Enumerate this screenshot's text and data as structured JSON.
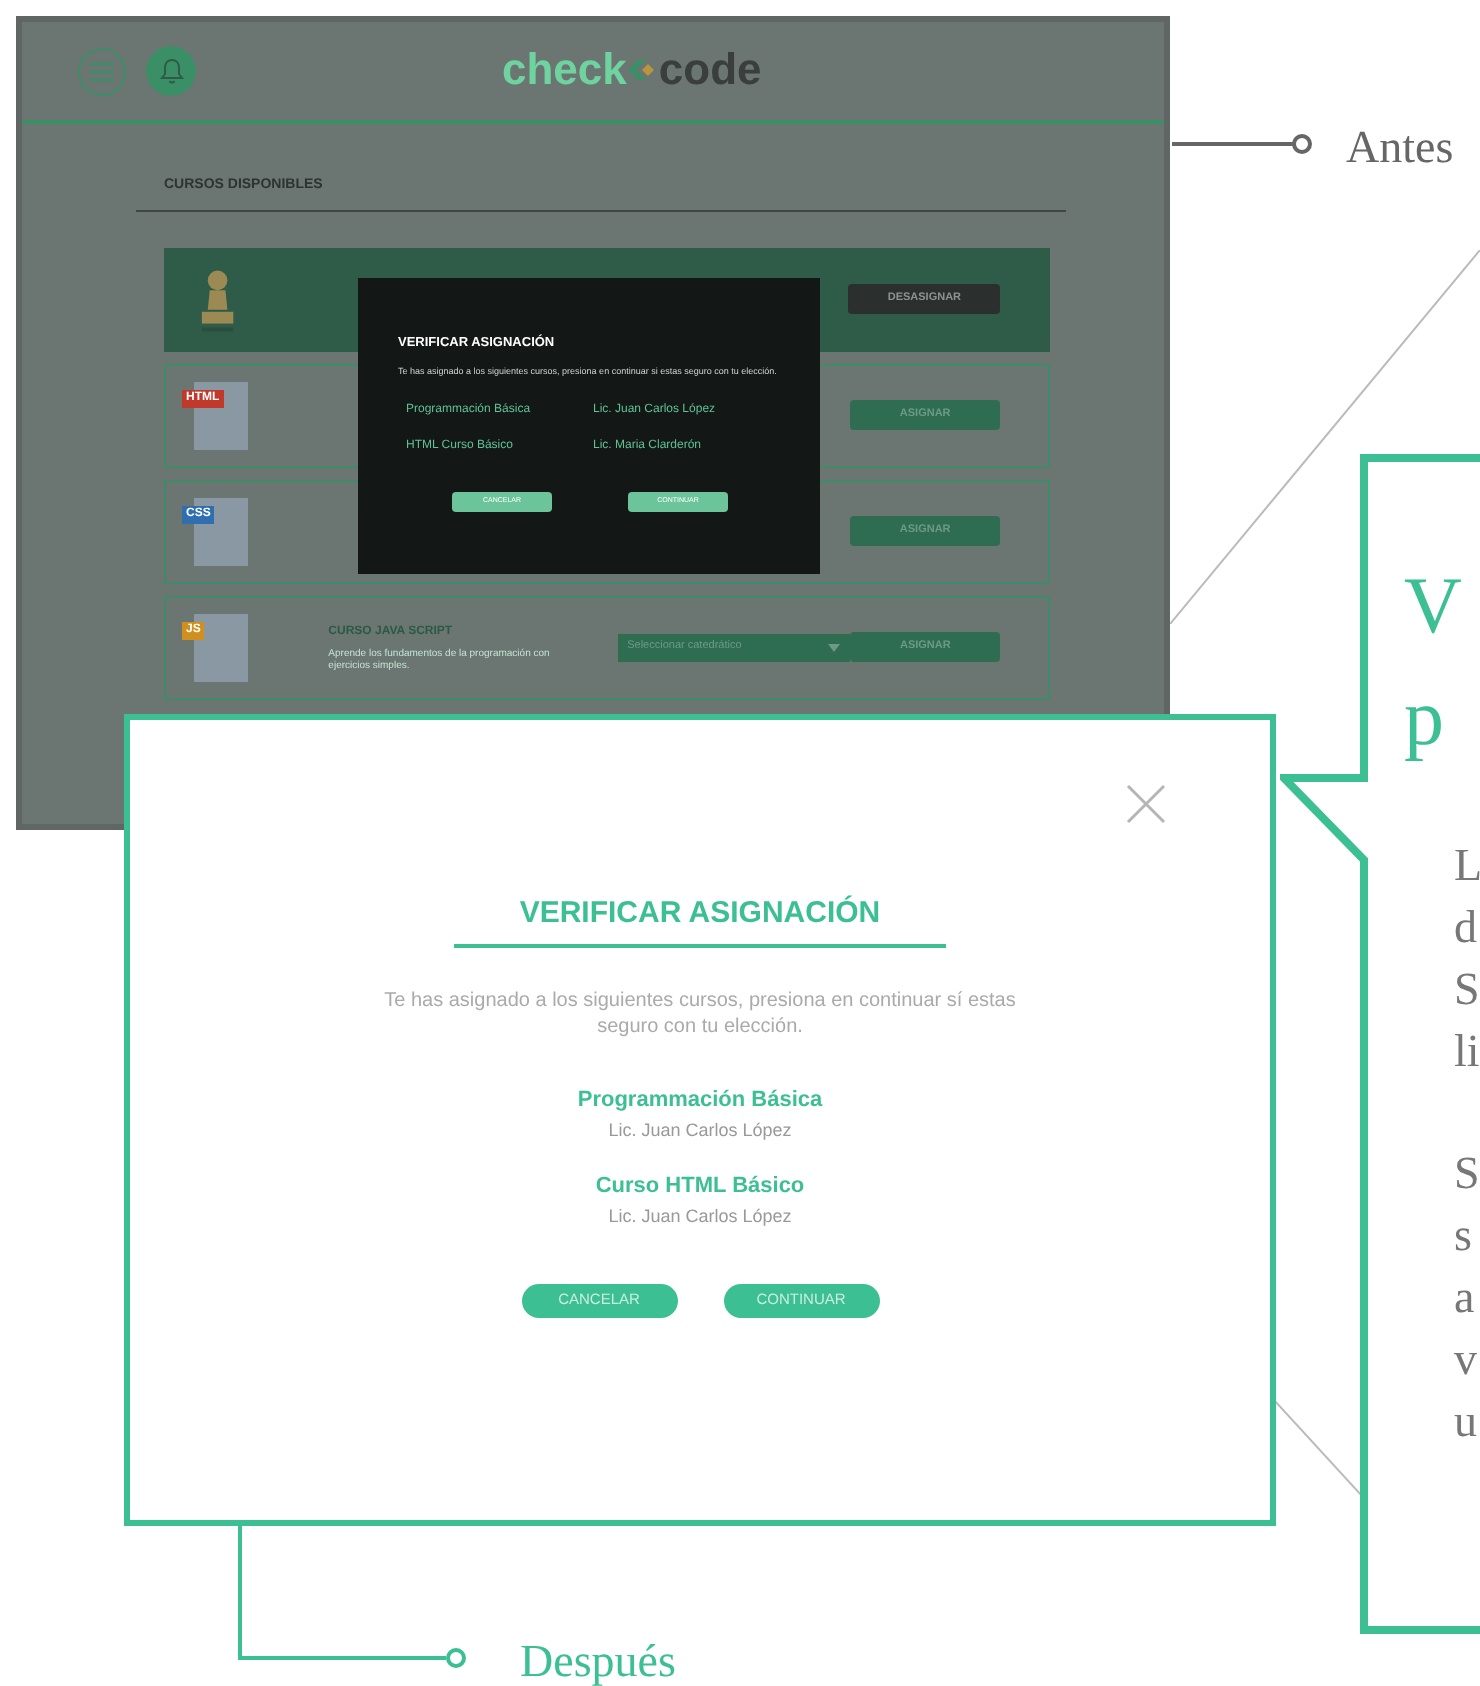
{
  "before_screen": {
    "logo": {
      "part_1": "check",
      "part_2": "code"
    },
    "section_title": "CURSOS DISPONIBLES",
    "courses": [
      {
        "kind": "pawn",
        "selected": true,
        "button": "DESASIGNAR"
      },
      {
        "kind": "html",
        "icon_label": "HTML",
        "selected": false,
        "button": "ASIGNAR"
      },
      {
        "kind": "css",
        "icon_label": "CSS",
        "selected": false,
        "button": "ASIGNAR"
      },
      {
        "kind": "js",
        "icon_label": "JS",
        "selected": false,
        "title": "CURSO JAVA SCRIPT",
        "description": "Aprende los fundamentos de la programación con ejercicios simples.",
        "select": "Seleccionar catedrático",
        "button": "ASIGNAR"
      }
    ],
    "modal": {
      "title": "VERIFICAR ASIGNACIÓN",
      "message": "Te has asignado a los siguientes cursos, presiona en continuar si estas seguro con tu elección.",
      "assignments": [
        {
          "course": "Programmación Básica",
          "teacher": "Lic. Juan Carlos López"
        },
        {
          "course": "HTML Curso Básico",
          "teacher": "Lic. Maria Clarderón"
        }
      ],
      "buttons": [
        "CANCELAR",
        "CONTINUAR"
      ]
    }
  },
  "before_label": "Antes",
  "after_modal": {
    "title": "VERIFICAR ASIGNACIÓN",
    "message": "Te has asignado a los siguientes cursos, presiona en continuar sí estas seguro con tu elección.",
    "courses": [
      {
        "name": "Programmación Básica",
        "teacher": "Lic. Juan Carlos López"
      },
      {
        "name": "Curso HTML Básico",
        "teacher": "Lic. Juan Carlos López"
      }
    ],
    "buttons": [
      "CANCELAR",
      "CONTINUAR"
    ]
  },
  "after_label": "Después",
  "side_panel": {
    "heading_lines": [
      "V",
      "p"
    ],
    "paragraphs": [
      [
        "L",
        "d",
        "S",
        "li"
      ],
      [
        "S",
        "s",
        "a",
        "v",
        "u"
      ]
    ]
  }
}
